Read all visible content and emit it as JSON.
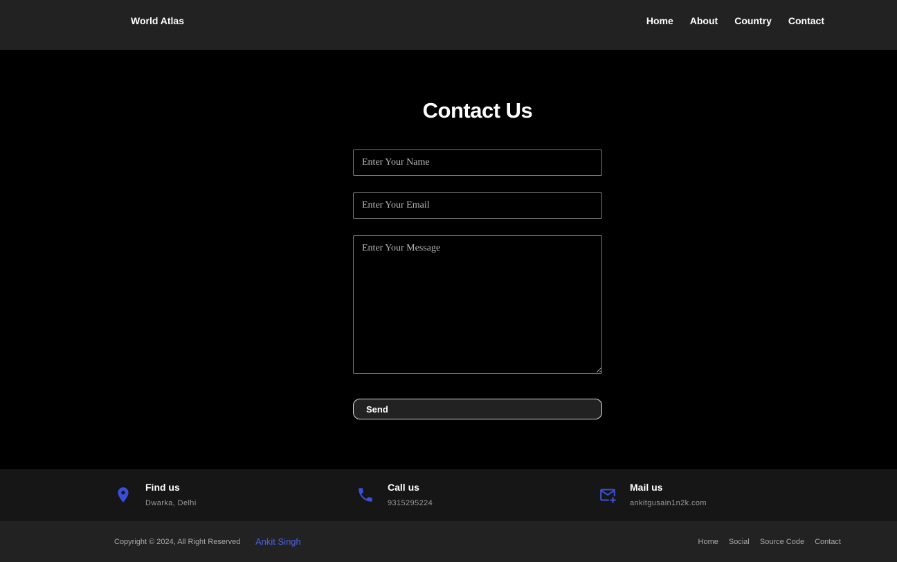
{
  "header": {
    "brand": "World Atlas",
    "nav": [
      "Home",
      "About",
      "Country",
      "Contact"
    ]
  },
  "contact": {
    "title": "Contact Us",
    "name_placeholder": "Enter Your Name",
    "email_placeholder": "Enter Your Email",
    "message_placeholder": "Enter Your Message",
    "send_label": "Send"
  },
  "info": [
    {
      "title": "Find us",
      "value": "Dwarka, Delhi",
      "icon": "location-pin-icon"
    },
    {
      "title": "Call us",
      "value": "9315295224",
      "icon": "phone-icon"
    },
    {
      "title": "Mail us",
      "value": "ankitgusain1n2k.com",
      "icon": "mail-plus-icon"
    }
  ],
  "footer": {
    "copyright": "Copyright © 2024, All Right Reserved",
    "author": "Ankit Singh",
    "links": [
      "Home",
      "Social",
      "Source Code",
      "Contact"
    ]
  },
  "colors": {
    "accent": "#3a4fd6",
    "header_bg": "#222222",
    "info_bg": "#161616"
  }
}
